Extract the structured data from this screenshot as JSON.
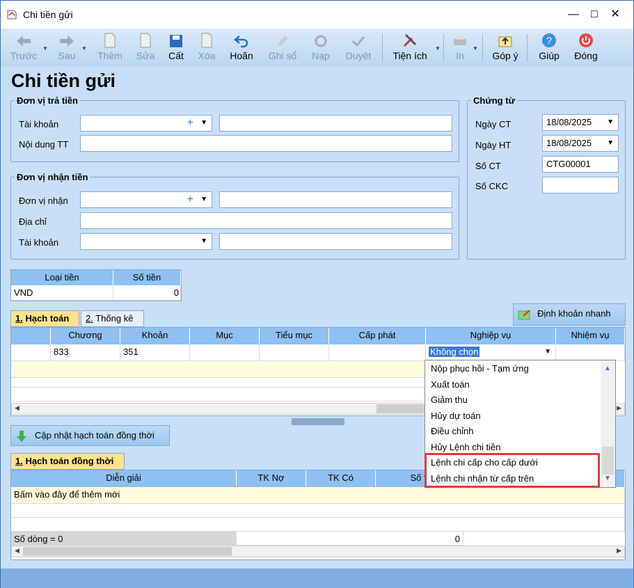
{
  "window": {
    "title": "Chi tiền gửi"
  },
  "toolbar": [
    {
      "label": "Trước",
      "icon": "arrow-left-icon",
      "enabled": false
    },
    {
      "label": "Sau",
      "icon": "arrow-right-icon",
      "enabled": false
    },
    {
      "label": "Thêm",
      "icon": "add-document-icon",
      "enabled": false
    },
    {
      "label": "Sửa",
      "icon": "edit-document-icon",
      "enabled": false
    },
    {
      "label": "Cất",
      "icon": "save-icon",
      "enabled": true
    },
    {
      "label": "Xóa",
      "icon": "delete-document-icon",
      "enabled": false
    },
    {
      "label": "Hoãn",
      "icon": "undo-icon",
      "enabled": true
    },
    {
      "label": "Ghi sổ",
      "icon": "pencil-icon",
      "enabled": false
    },
    {
      "label": "Nạp",
      "icon": "refresh-icon",
      "enabled": false
    },
    {
      "label": "Duyệt",
      "icon": "checkmark-icon",
      "enabled": false
    },
    {
      "label": "Tiện ích",
      "icon": "tools-icon",
      "enabled": true
    },
    {
      "label": "In",
      "icon": "printer-icon",
      "enabled": false
    },
    {
      "label": "Góp ý",
      "icon": "upload-icon",
      "enabled": true
    },
    {
      "label": "Giúp",
      "icon": "help-icon",
      "enabled": true
    },
    {
      "label": "Đóng",
      "icon": "power-icon",
      "enabled": true
    }
  ],
  "form": {
    "heading": "Chi tiền gửi",
    "payer": {
      "legend": "Đơn vị trả tiền",
      "account_label": "Tài khoản",
      "content_label": "Nội dung TT",
      "account_value": "",
      "account_name": "",
      "content_value": ""
    },
    "payee": {
      "legend": "Đơn vị nhận tiền",
      "unit_label": "Đơn vị nhận",
      "address_label": "Địa chỉ",
      "account_label": "Tài khoản",
      "unit_value": "",
      "unit_name": "",
      "address_value": "",
      "account_value": "",
      "account_name": ""
    },
    "voucher": {
      "legend": "Chứng từ",
      "date_ct_label": "Ngày CT",
      "date_ct": "18/08/2025",
      "date_ht_label": "Ngày HT",
      "date_ht": "18/08/2025",
      "number_label": "Số CT",
      "number": "CTG00001",
      "ckc_label": "Số CKC",
      "ckc": ""
    },
    "currency": {
      "headers": [
        "Loại tiền",
        "Số tiền"
      ],
      "currency": "VND",
      "amount": "0"
    }
  },
  "tabs1": [
    {
      "num": "1.",
      "label": " Hạch toán"
    },
    {
      "num": "2.",
      "label": " Thống kê"
    }
  ],
  "quick_button": "Định khoản nhanh",
  "grid1": {
    "headers": [
      "Chương",
      "Khoản",
      "Mục",
      "Tiểu mục",
      "Cấp phát",
      "Nghiệp vụ",
      "Nhiệm vụ"
    ],
    "row": {
      "chuong": "833",
      "khoan": "351",
      "nghiep_vu": "Không chọn"
    }
  },
  "dropdown": {
    "items": [
      "Nộp phục hồi - Tạm ứng",
      "Xuất toán",
      "Giảm thu",
      "Hủy dự toán",
      "Điều chỉnh",
      "Hủy Lệnh chi tiền",
      "Lệnh chi cấp cho cấp dưới",
      "Lệnh chi nhận từ cấp trên"
    ],
    "highlighted": [
      6,
      7
    ]
  },
  "update_button": "Cập nhật hạch toán đồng thời",
  "tabs2": [
    {
      "num": "1.",
      "label": " Hạch toán đồng thời"
    }
  ],
  "grid2": {
    "headers": [
      "Diễn giải",
      "TK Nợ",
      "TK Có",
      "Số ti"
    ],
    "add_row": "Bấm vào đây để thêm mới",
    "footer_count": "Số dòng = 0",
    "footer_sum": "0"
  },
  "colors": {
    "header_blue": "#8ec0f3",
    "tab_active": "#ffe28d",
    "highlight_red": "#e23a3a",
    "row_yellow": "#fffbdc"
  }
}
